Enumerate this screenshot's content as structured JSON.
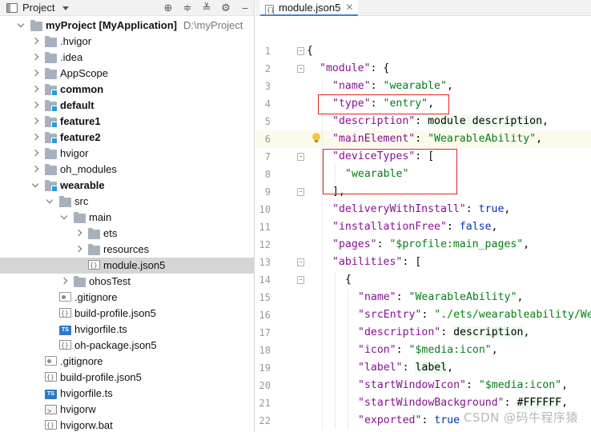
{
  "project_panel": {
    "title": "Project",
    "toolbar_icons": [
      "locate-icon",
      "expand-all-icon",
      "collapse-all-icon",
      "settings-icon",
      "hide-icon"
    ],
    "tree": [
      {
        "label": "myProject",
        "suffix": "[MyApplication]",
        "path": "D:\\myProject",
        "bold": true,
        "indent": 0,
        "arrow": "down",
        "icon": "folder"
      },
      {
        "label": ".hvigor",
        "indent": 1,
        "arrow": "right",
        "icon": "folder"
      },
      {
        "label": ".idea",
        "indent": 1,
        "arrow": "right",
        "icon": "folder"
      },
      {
        "label": "AppScope",
        "indent": 1,
        "arrow": "right",
        "icon": "folder"
      },
      {
        "label": "common",
        "indent": 1,
        "arrow": "right",
        "icon": "module",
        "bold": true
      },
      {
        "label": "default",
        "indent": 1,
        "arrow": "right",
        "icon": "module",
        "bold": true
      },
      {
        "label": "feature1",
        "indent": 1,
        "arrow": "right",
        "icon": "module",
        "bold": true
      },
      {
        "label": "feature2",
        "indent": 1,
        "arrow": "right",
        "icon": "module",
        "bold": true
      },
      {
        "label": "hvigor",
        "indent": 1,
        "arrow": "right",
        "icon": "folder"
      },
      {
        "label": "oh_modules",
        "indent": 1,
        "arrow": "right",
        "icon": "folder"
      },
      {
        "label": "wearable",
        "indent": 1,
        "arrow": "down",
        "icon": "module",
        "bold": true
      },
      {
        "label": "src",
        "indent": 2,
        "arrow": "down",
        "icon": "folder"
      },
      {
        "label": "main",
        "indent": 3,
        "arrow": "down",
        "icon": "folder"
      },
      {
        "label": "ets",
        "indent": 4,
        "arrow": "right",
        "icon": "folder"
      },
      {
        "label": "resources",
        "indent": 4,
        "arrow": "right",
        "icon": "folder"
      },
      {
        "label": "module.json5",
        "indent": 4,
        "arrow": "",
        "icon": "json",
        "selected": true
      },
      {
        "label": "ohosTest",
        "indent": 3,
        "arrow": "right",
        "icon": "folder"
      },
      {
        "label": ".gitignore",
        "indent": 2,
        "arrow": "",
        "icon": "git"
      },
      {
        "label": "build-profile.json5",
        "indent": 2,
        "arrow": "",
        "icon": "json"
      },
      {
        "label": "hvigorfile.ts",
        "indent": 2,
        "arrow": "",
        "icon": "ts"
      },
      {
        "label": "oh-package.json5",
        "indent": 2,
        "arrow": "",
        "icon": "json"
      },
      {
        "label": ".gitignore",
        "indent": 1,
        "arrow": "",
        "icon": "git"
      },
      {
        "label": "build-profile.json5",
        "indent": 1,
        "arrow": "",
        "icon": "json"
      },
      {
        "label": "hvigorfile.ts",
        "indent": 1,
        "arrow": "",
        "icon": "ts"
      },
      {
        "label": "hvigorw",
        "indent": 1,
        "arrow": "",
        "icon": "term"
      },
      {
        "label": "hvigorw.bat",
        "indent": 1,
        "arrow": "",
        "icon": "json"
      }
    ]
  },
  "editor": {
    "tab_label": "module.json5",
    "lines": [
      {
        "n": "1",
        "fold": true,
        "indent": 0,
        "tokens": [
          [
            "pun",
            "{"
          ]
        ]
      },
      {
        "n": "2",
        "fold": true,
        "indent": 1,
        "tokens": [
          [
            "key",
            "\"module\""
          ],
          [
            "pun",
            ": {"
          ]
        ]
      },
      {
        "n": "3",
        "indent": 2,
        "tokens": [
          [
            "key",
            "\"name\""
          ],
          [
            "pun",
            ": "
          ],
          [
            "str",
            "\"wearable\""
          ],
          [
            "pun",
            ","
          ]
        ]
      },
      {
        "n": "4",
        "indent": 2,
        "tokens": [
          [
            "key",
            "\"type\""
          ],
          [
            "pun",
            ": "
          ],
          [
            "str",
            "\"entry\""
          ],
          [
            "pun",
            ","
          ]
        ]
      },
      {
        "n": "5",
        "indent": 2,
        "tokens": [
          [
            "key",
            "\"description\""
          ],
          [
            "pun",
            ": "
          ],
          [
            "val",
            "module description"
          ],
          [
            "pun",
            ","
          ]
        ]
      },
      {
        "n": "6",
        "indent": 2,
        "highlight": true,
        "bulb": true,
        "tokens": [
          [
            "key",
            "\"mainElement\""
          ],
          [
            "pun",
            ": "
          ],
          [
            "str",
            "\"WearableAbility\""
          ],
          [
            "pun",
            ","
          ]
        ]
      },
      {
        "n": "7",
        "fold": true,
        "indent": 2,
        "tokens": [
          [
            "key",
            "\"deviceTypes\""
          ],
          [
            "pun",
            ": ["
          ]
        ]
      },
      {
        "n": "8",
        "indent": 3,
        "tokens": [
          [
            "str",
            "\"wearable\""
          ]
        ]
      },
      {
        "n": "9",
        "fold": true,
        "indent": 2,
        "tokens": [
          [
            "pun",
            "],"
          ]
        ]
      },
      {
        "n": "10",
        "indent": 2,
        "tokens": [
          [
            "key",
            "\"deliveryWithInstall\""
          ],
          [
            "pun",
            ": "
          ],
          [
            "kw",
            "true"
          ],
          [
            "pun",
            ","
          ]
        ]
      },
      {
        "n": "11",
        "indent": 2,
        "tokens": [
          [
            "key",
            "\"installationFree\""
          ],
          [
            "pun",
            ": "
          ],
          [
            "kw",
            "false"
          ],
          [
            "pun",
            ","
          ]
        ]
      },
      {
        "n": "12",
        "indent": 2,
        "tokens": [
          [
            "key",
            "\"pages\""
          ],
          [
            "pun",
            ": "
          ],
          [
            "str",
            "\"$profile:main_pages\""
          ],
          [
            "pun",
            ","
          ]
        ]
      },
      {
        "n": "13",
        "fold": true,
        "indent": 2,
        "tokens": [
          [
            "key",
            "\"abilities\""
          ],
          [
            "pun",
            ": ["
          ]
        ]
      },
      {
        "n": "14",
        "fold": true,
        "indent": 3,
        "tokens": [
          [
            "pun",
            "{"
          ]
        ]
      },
      {
        "n": "15",
        "indent": 4,
        "tokens": [
          [
            "key",
            "\"name\""
          ],
          [
            "pun",
            ": "
          ],
          [
            "str",
            "\"WearableAbility\""
          ],
          [
            "pun",
            ","
          ]
        ]
      },
      {
        "n": "16",
        "indent": 4,
        "tokens": [
          [
            "key",
            "\"srcEntry\""
          ],
          [
            "pun",
            ": "
          ],
          [
            "str",
            "\"./ets/wearableability/We"
          ]
        ]
      },
      {
        "n": "17",
        "indent": 4,
        "tokens": [
          [
            "key",
            "\"description\""
          ],
          [
            "pun",
            ": "
          ],
          [
            "val",
            "description"
          ],
          [
            "pun",
            ","
          ]
        ]
      },
      {
        "n": "18",
        "indent": 4,
        "tokens": [
          [
            "key",
            "\"icon\""
          ],
          [
            "pun",
            ": "
          ],
          [
            "str",
            "\"$media:icon\""
          ],
          [
            "pun",
            ","
          ]
        ]
      },
      {
        "n": "19",
        "indent": 4,
        "tokens": [
          [
            "key",
            "\"label\""
          ],
          [
            "pun",
            ": "
          ],
          [
            "val",
            "label"
          ],
          [
            "pun",
            ","
          ]
        ]
      },
      {
        "n": "20",
        "indent": 4,
        "tokens": [
          [
            "key",
            "\"startWindowIcon\""
          ],
          [
            "pun",
            ": "
          ],
          [
            "str",
            "\"$media:icon\""
          ],
          [
            "pun",
            ","
          ]
        ]
      },
      {
        "n": "21",
        "indent": 4,
        "tokens": [
          [
            "key",
            "\"startWindowBackground\""
          ],
          [
            "pun",
            ": "
          ],
          [
            "val",
            "#FFFFFF"
          ],
          [
            "pun",
            ","
          ]
        ]
      },
      {
        "n": "22",
        "indent": 4,
        "tokens": [
          [
            "key",
            "\"exported\""
          ],
          [
            "pun",
            ": "
          ],
          [
            "kw",
            "true"
          ]
        ]
      }
    ]
  },
  "watermark": "CSDN @码牛程序猿",
  "colors": {
    "key": "#871094",
    "string": "#067d17",
    "keyword": "#0033b3",
    "annotation": "#e2231a",
    "selection": "#d5d5d5"
  }
}
